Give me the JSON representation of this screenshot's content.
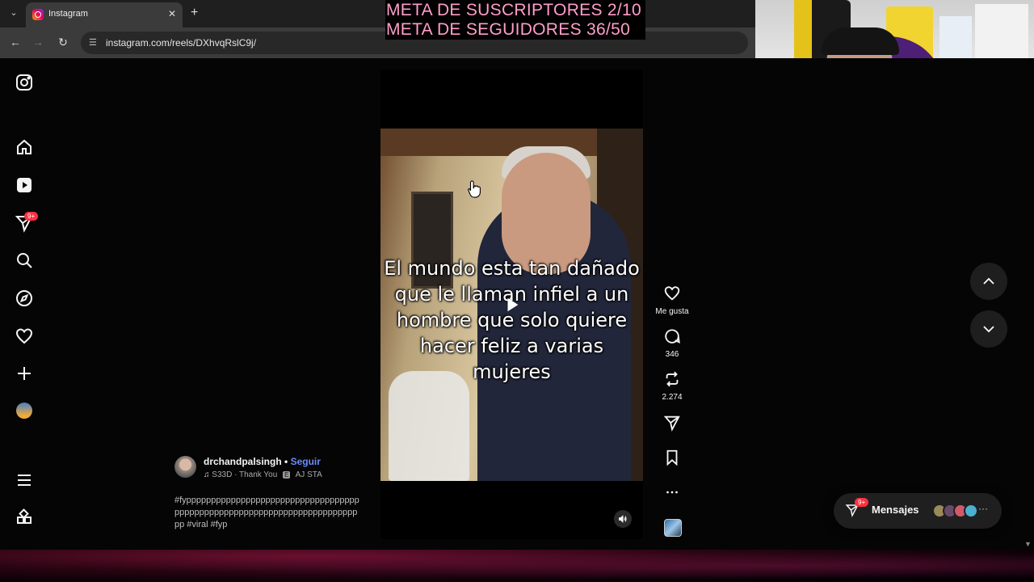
{
  "browser": {
    "tab_title": "Instagram",
    "url": "instagram.com/reels/DXhvqRslC9j/"
  },
  "stream_overlay": {
    "line1": "META DE SUSCRIPTORES 2/10",
    "line2": "META DE SEGUIDORES 36/50"
  },
  "sidebar": {
    "notifications_badge": "9+",
    "icons": [
      "instagram-logo-icon",
      "home-icon",
      "reels-icon",
      "messages-icon",
      "search-icon",
      "explore-icon",
      "heart-icon",
      "create-icon",
      "profile-avatar",
      "menu-icon",
      "more-apps-icon"
    ]
  },
  "reel": {
    "caption_overlay": "El mundo esta tan dañado que le llaman infiel a un hombre que solo quiere hacer feliz a varias mujeres",
    "username": "drchandpalsingh",
    "separator": "•",
    "follow_label": "Seguir",
    "music_part1": "S33D · Thank You",
    "explicit": "E",
    "music_part2": "AJ STA",
    "caption": "#fypppppppppppppppppppppppppppppppppppppppppppppppppppppppppppppppppppppppppp #viral #fyp"
  },
  "actions": {
    "like_label": "Me gusta",
    "comments_count": "346",
    "reposts_count": "2.274"
  },
  "messages": {
    "badge": "9+",
    "label": "Mensajes",
    "more": "···"
  },
  "colors": {
    "overlay_text": "#ff9ec8",
    "follow_link": "#6b8cff",
    "badge": "#ff3040"
  }
}
